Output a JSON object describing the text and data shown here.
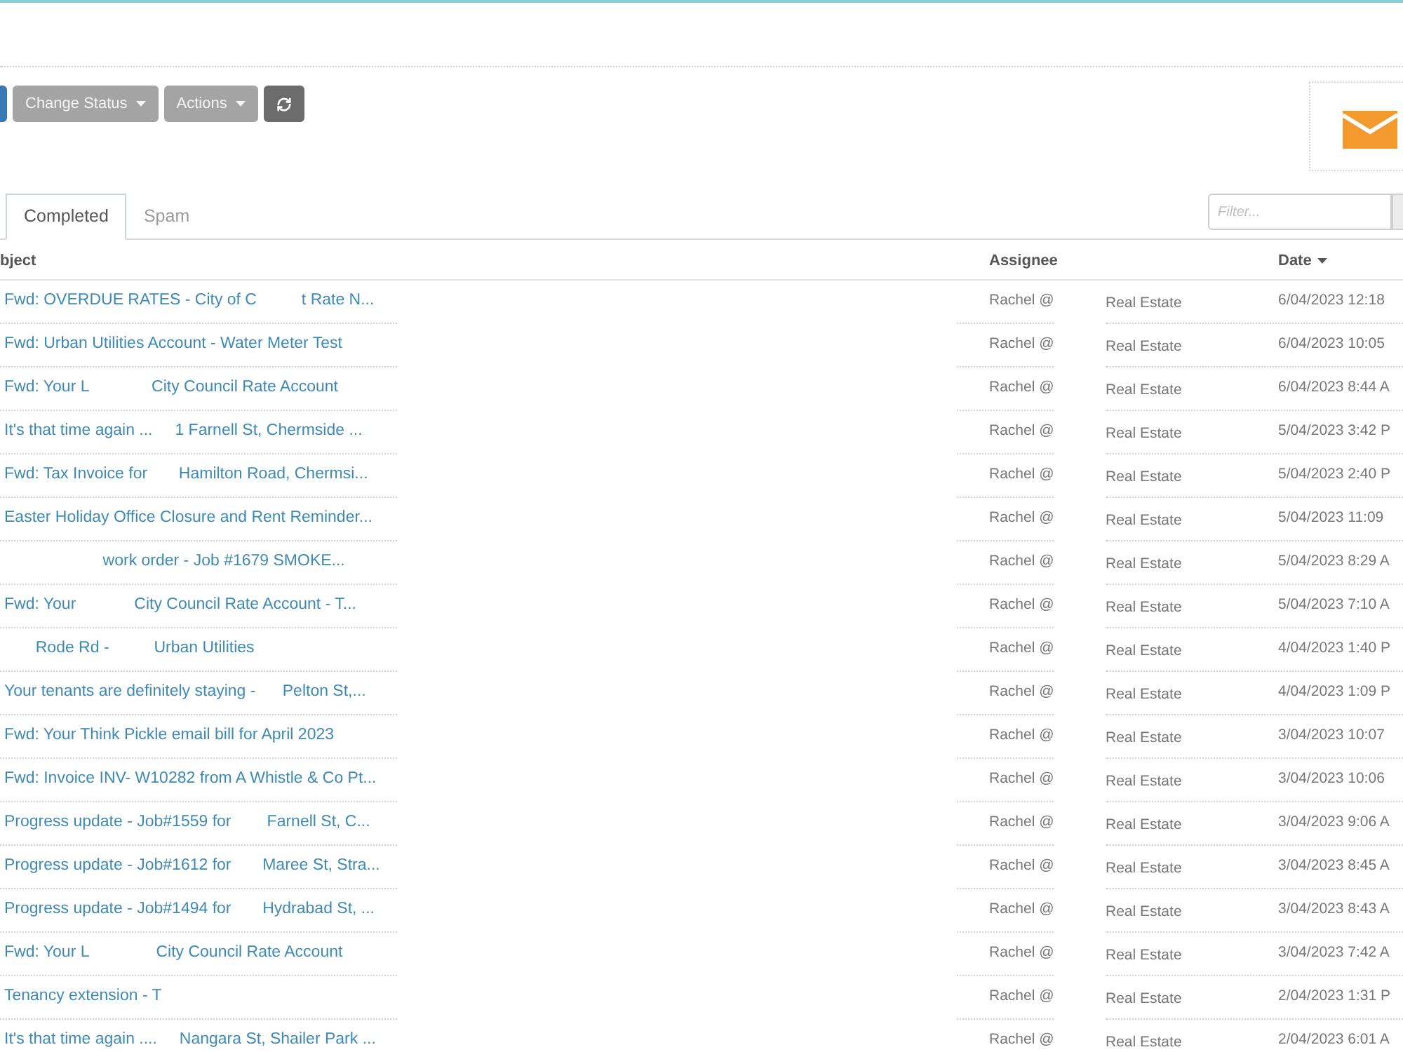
{
  "toolbar": {
    "buttons": [
      {
        "kind": "primary"
      },
      {
        "kind": "dropdown",
        "label": "Change Status"
      },
      {
        "kind": "dropdown",
        "label": "Actions"
      },
      {
        "kind": "refresh"
      }
    ]
  },
  "tabs": [
    {
      "label": "Completed",
      "selected": true
    },
    {
      "label": "Spam",
      "selected": false
    }
  ],
  "filter": {
    "placeholder": "Filter..."
  },
  "table": {
    "header": {
      "subject": {
        "label": "bject",
        "sorted": false
      },
      "assignee": {
        "label": "Assignee",
        "sorted": false
      },
      "date": {
        "label": "Date",
        "sorted": true
      }
    },
    "rows": [
      {
        "subject": "Fwd: OVERDUE RATES - City of C          t Rate N...",
        "assignee": "Rachel @",
        "column_3": "Real Estate",
        "date": "6/04/2023 12:18"
      },
      {
        "subject": "Fwd: Urban Utilities Account - Water Meter Test",
        "assignee": "Rachel @",
        "column_3": "Real Estate",
        "date": "6/04/2023 10:05"
      },
      {
        "subject": "Fwd: Your L              City Council Rate Account",
        "assignee": "Rachel @",
        "column_3": "Real Estate",
        "date": "6/04/2023 8:44 A"
      },
      {
        "subject": "It's that time again ...     1 Farnell St, Chermside ...",
        "assignee": "Rachel @",
        "column_3": "Real Estate",
        "date": "5/04/2023 3:42 P"
      },
      {
        "subject": "Fwd: Tax Invoice for       Hamilton Road, Chermsi...",
        "assignee": "Rachel @",
        "column_3": "Real Estate",
        "date": "5/04/2023 2:40 P"
      },
      {
        "subject": "Easter Holiday Office Closure and Rent Reminder...",
        "assignee": "Rachel @",
        "column_3": "Real Estate",
        "date": "5/04/2023 11:09"
      },
      {
        "subject": "                      work order - Job #1679 SMOKE...",
        "assignee": "Rachel @",
        "column_3": "Real Estate",
        "date": "5/04/2023 8:29 A"
      },
      {
        "subject": "Fwd: Your             City Council Rate Account - T...",
        "assignee": "Rachel @",
        "column_3": "Real Estate",
        "date": "5/04/2023 7:10 A"
      },
      {
        "subject": "       Rode Rd -          Urban Utilities",
        "assignee": "Rachel @",
        "column_3": "Real Estate",
        "date": "4/04/2023 1:40 P"
      },
      {
        "subject": "Your tenants are definitely staying -      Pelton St,...",
        "assignee": "Rachel @",
        "column_3": "Real Estate",
        "date": "4/04/2023 1:09 P"
      },
      {
        "subject": "Fwd: Your Think Pickle email bill for April 2023",
        "assignee": "Rachel @",
        "column_3": "Real Estate",
        "date": "3/04/2023 10:07"
      },
      {
        "subject": "Fwd: Invoice INV- W10282 from A Whistle & Co Pt...",
        "assignee": "Rachel @",
        "column_3": "Real Estate",
        "date": "3/04/2023 10:06"
      },
      {
        "subject": "Progress update - Job#1559 for        Farnell St, C...",
        "assignee": "Rachel @",
        "column_3": "Real Estate",
        "date": "3/04/2023 9:06 A"
      },
      {
        "subject": "Progress update - Job#1612 for       Maree St, Stra...",
        "assignee": "Rachel @",
        "column_3": "Real Estate",
        "date": "3/04/2023 8:45 A"
      },
      {
        "subject": "Progress update - Job#1494 for       Hydrabad St, ...",
        "assignee": "Rachel @",
        "column_3": "Real Estate",
        "date": "3/04/2023 8:43 A"
      },
      {
        "subject": "Fwd: Your L               City Council Rate Account",
        "assignee": "Rachel @",
        "column_3": "Real Estate",
        "date": "3/04/2023 7:42 A"
      },
      {
        "subject": "Tenancy extension - T",
        "assignee": "Rachel @",
        "column_3": "Real Estate",
        "date": "2/04/2023 1:31 P"
      },
      {
        "subject": "It's that time again ....     Nangara St, Shailer Park ...",
        "assignee": "Rachel @",
        "column_3": "Real Estate",
        "date": "2/04/2023 6:01 A"
      }
    ]
  }
}
